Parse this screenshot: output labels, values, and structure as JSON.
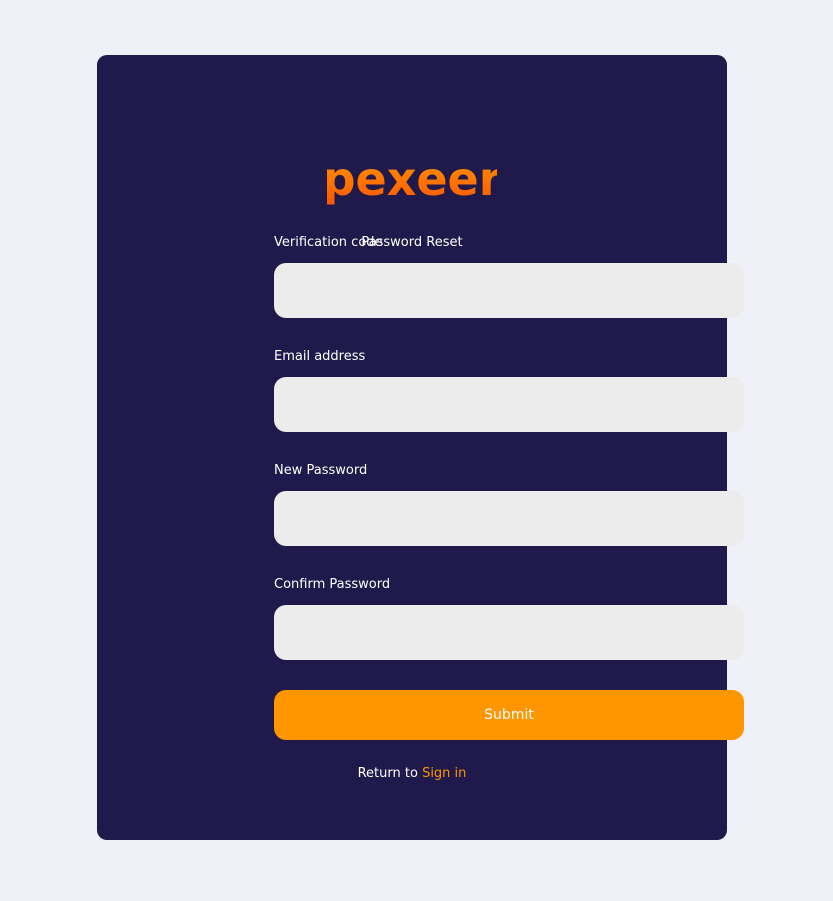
{
  "brand": {
    "logo_text": "pexeer",
    "logo_color_top": "#ff9a00",
    "logo_color_bottom": "#ff5400"
  },
  "page": {
    "subtitle": "Password Reset",
    "background": "#eff0f8",
    "card_color": "#1f1a4b",
    "accent": "#ff9500"
  },
  "form": {
    "verification": {
      "label": "Verification code",
      "value": "",
      "placeholder": ""
    },
    "email": {
      "label": "Email address",
      "value": "",
      "placeholder": ""
    },
    "new_password": {
      "label": "New Password",
      "value": "",
      "placeholder": ""
    },
    "confirm_password": {
      "label": "Confirm Password",
      "value": "",
      "placeholder": ""
    },
    "submit_label": "Submit"
  },
  "footer": {
    "return_text": "Return to",
    "signin_label": "Sign in"
  }
}
